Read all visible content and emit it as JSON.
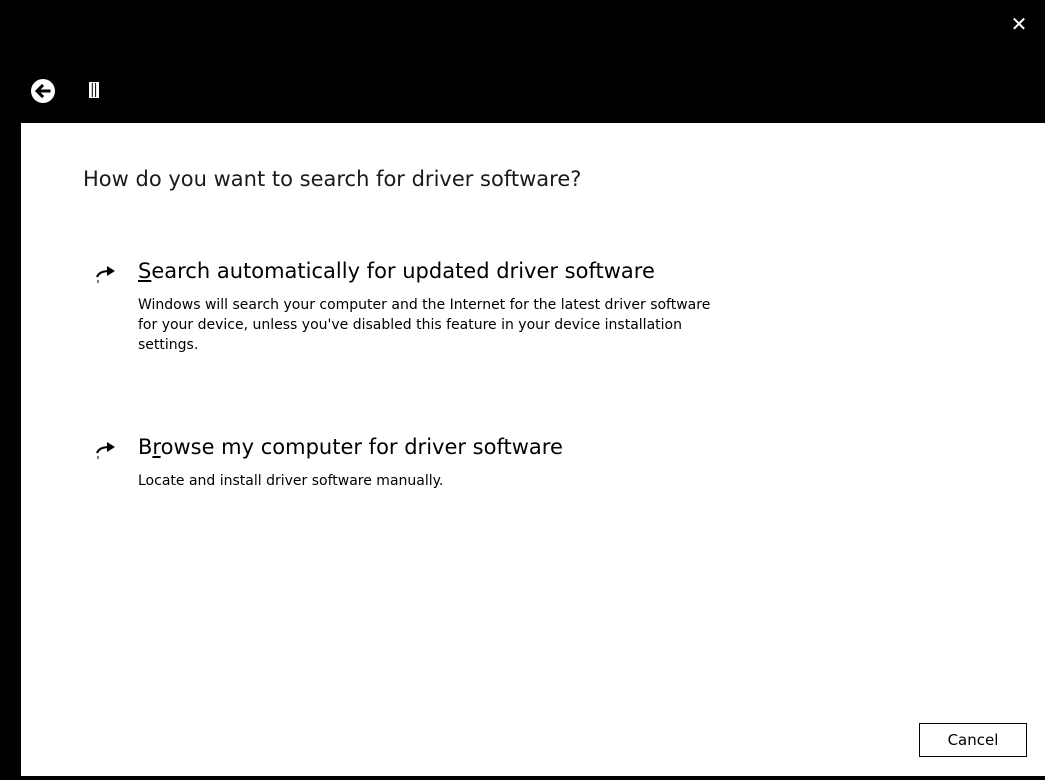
{
  "titlebar": {
    "close_symbol": "✕",
    "back_icon": "back-arrow-icon",
    "device_icon": "device-icon"
  },
  "main": {
    "heading": "How do you want to search for driver software?",
    "options": [
      {
        "icon": "right-arrow-icon",
        "accel": "S",
        "title_rest": "earch automatically for updated driver software",
        "desc_lines": [
          "Windows will search your computer and the Internet for the latest driver software",
          "for your device, unless you've disabled this feature in your device installation",
          "settings."
        ]
      },
      {
        "icon": "right-arrow-icon",
        "title_pre": "B",
        "accel": "r",
        "title_rest": "owse my computer for driver software",
        "desc_lines": [
          "Locate and install driver software manually."
        ]
      }
    ]
  },
  "footer": {
    "cancel_label": "Cancel"
  },
  "colors": {
    "titlebar_bg": "#000000",
    "content_bg": "#ffffff",
    "text": "#000000"
  }
}
